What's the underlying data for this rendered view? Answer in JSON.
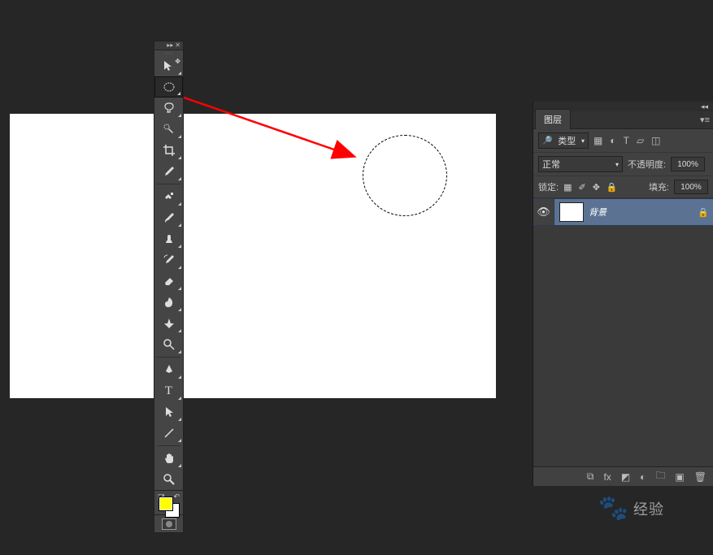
{
  "panel": {
    "tab": "图层",
    "menuGlyph": "▾≡"
  },
  "filter": {
    "kind": "类型",
    "icons": {
      "image": "▦",
      "adjust": "◐",
      "type": "T",
      "shape": "▱",
      "smart": "◫"
    }
  },
  "blend": {
    "mode": "正常",
    "opacityLabel": "不透明度:",
    "opacityValue": "100%"
  },
  "lock": {
    "label": "锁定:",
    "icons": {
      "transparent": "▦",
      "brush": "✐",
      "move": "✥",
      "all": "🔒"
    },
    "fillLabel": "填充:",
    "fillValue": "100%"
  },
  "layers": [
    {
      "name": "背景",
      "visible": true,
      "locked": true
    }
  ],
  "footerIcons": {
    "link": "⧉",
    "fx": "fx",
    "mask": "◩",
    "adjust": "◐",
    "group": "🗀",
    "new": "▣",
    "trash": "🗑"
  },
  "colors": {
    "foreground": "#ffff00",
    "background": "#ffffff"
  },
  "watermark": {
    "text": "经验"
  }
}
